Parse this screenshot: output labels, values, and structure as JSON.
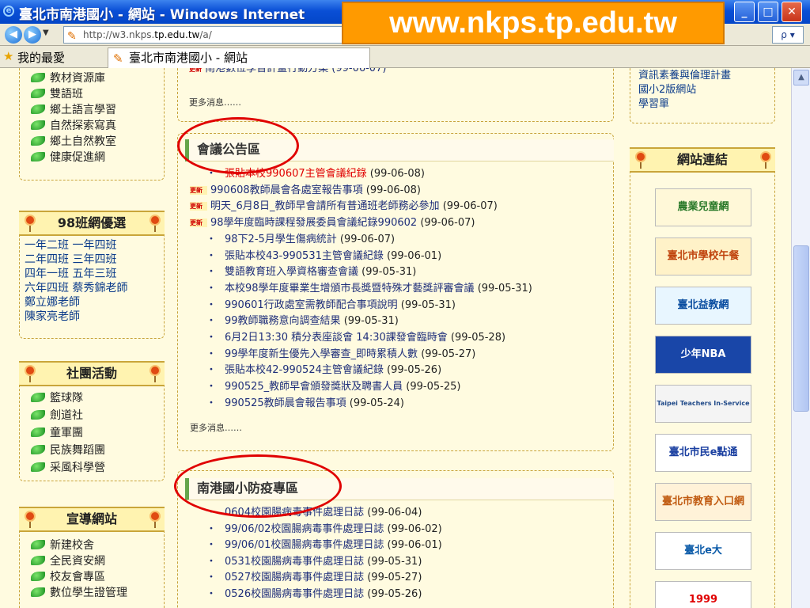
{
  "window": {
    "title": "臺北市南港國小 - 網站 - Windows Internet",
    "buttons": [
      "_",
      "□",
      "✕"
    ]
  },
  "banner_url": "www.nkps.tp.edu.tw",
  "address_bar": {
    "url_prefix": "http://w3.nkps.",
    "url_domain": "tp.edu.tw",
    "url_suffix": "/a/",
    "search_icon_label": "ρ"
  },
  "favorites_bar": {
    "favorites_label": "我的最愛",
    "tab_title": "臺北市南港國小 - 網站"
  },
  "left_sidebar": {
    "top_links": [
      "教材資源庫",
      "雙語班",
      "鄉土語言學習",
      "自然探索寫真",
      "鄉土自然教室",
      "健康促進網"
    ],
    "class_box": {
      "title": "98班網優選",
      "lines": [
        "一年二班 一年四班",
        "二年四班 三年四班",
        "四年一班 五年三班",
        "六年四班 蔡秀錦老師",
        "鄭立娜老師",
        "陳家亮老師"
      ]
    },
    "club_box": {
      "title": "社團活動",
      "links": [
        "籃球隊",
        "劍道社",
        "童軍團",
        "民族舞蹈團",
        "采風科學營"
      ]
    },
    "promo_box": {
      "title": "宣導網站",
      "links": [
        "新建校舍",
        "全民資安網",
        "校友會專區",
        "數位學生證管理"
      ]
    }
  },
  "main": {
    "top_partial_item": "南港數位學習計畫行動方案 (99-06-07)",
    "more_label": "更多消息……",
    "meetings": {
      "title": "會議公告區",
      "items": [
        {
          "text": "張貼本校990607主管會議紀錄",
          "date": "(99-06-08)",
          "new": false,
          "red": true
        },
        {
          "text": "990608教師晨會各處室報告事項",
          "date": "(99-06-08)",
          "new": true,
          "red": false
        },
        {
          "text": "明天_6月8日_教師早會請所有普通班老師務必參加",
          "date": "(99-06-07)",
          "new": true,
          "red": false
        },
        {
          "text": "98學年度臨時課程發展委員會議紀錄990602",
          "date": "(99-06-07)",
          "new": true,
          "red": false
        },
        {
          "text": "98下2-5月學生傷病統計",
          "date": "(99-06-07)",
          "new": false,
          "red": false
        },
        {
          "text": "張貼本校43-990531主管會議紀錄",
          "date": "(99-06-01)",
          "new": false,
          "red": false
        },
        {
          "text": "雙語教育班入學資格審查會議",
          "date": "(99-05-31)",
          "new": false,
          "red": false
        },
        {
          "text": "本校98學年度畢業生增頒市長獎暨特殊才藝獎評審會議",
          "date": "(99-05-31)",
          "new": false,
          "red": false
        },
        {
          "text": "990601行政處室需教師配合事項說明",
          "date": "(99-05-31)",
          "new": false,
          "red": false
        },
        {
          "text": "99教師職務意向調查結果",
          "date": "(99-05-31)",
          "new": false,
          "red": false
        },
        {
          "text": "6月2日13:30 積分表座談會 14:30課發會臨時會",
          "date": "(99-05-28)",
          "new": false,
          "red": false
        },
        {
          "text": "99學年度新生優先入學審查_即時累積人數",
          "date": "(99-05-27)",
          "new": false,
          "red": false
        },
        {
          "text": "張貼本校42-990524主管會議紀錄",
          "date": "(99-05-26)",
          "new": false,
          "red": false
        },
        {
          "text": "990525_教師早會頒發獎狀及聘書人員",
          "date": "(99-05-25)",
          "new": false,
          "red": false
        },
        {
          "text": "990525教師晨會報告事項",
          "date": "(99-05-24)",
          "new": false,
          "red": false
        }
      ]
    },
    "epidemic": {
      "title": "南港國小防疫專區",
      "items": [
        {
          "text": "0604校園腸病毒事件處理日誌",
          "date": "(99-06-04)"
        },
        {
          "text": "99/06/02校園腸病毒事件處理日誌",
          "date": "(99-06-02)"
        },
        {
          "text": "99/06/01校園腸病毒事件處理日誌",
          "date": "(99-06-01)"
        },
        {
          "text": "0531校園腸病毒事件處理日誌",
          "date": "(99-05-31)"
        },
        {
          "text": "0527校園腸病毒事件處理日誌",
          "date": "(99-05-27)"
        },
        {
          "text": "0526校園腸病毒事件處理日誌",
          "date": "(99-05-26)"
        }
      ]
    },
    "new_badge": "更新",
    "bullet": "・"
  },
  "right_sidebar": {
    "top_links": [
      "資訊素養與倫理計畫",
      "國小2版網站",
      "學習單"
    ],
    "links_box": {
      "title": "網站連結",
      "logos": [
        {
          "label": "農業兒童網",
          "bg": "#fff8d8",
          "fg": "#2a7a2a"
        },
        {
          "label": "臺北市學校午餐",
          "bg": "#fff2c8",
          "fg": "#c0440e"
        },
        {
          "label": "臺北益教網",
          "bg": "#e8f6ff",
          "fg": "#0a4da0"
        },
        {
          "label": "少年NBA",
          "bg": "#1946a8",
          "fg": "#ffffff"
        },
        {
          "label": "Taipei Teachers In-Service Information",
          "bg": "#f4f4f4",
          "fg": "#234c8a"
        },
        {
          "label": "臺北市民e點通",
          "bg": "#ffffff",
          "fg": "#1a3fa0"
        },
        {
          "label": "臺北市教育入口網",
          "bg": "#fff2d8",
          "fg": "#c05a10"
        },
        {
          "label": "臺北e大",
          "bg": "#ffffff",
          "fg": "#0a5aa8"
        },
        {
          "label": "1999",
          "bg": "#ffffff",
          "fg": "#e00000"
        }
      ]
    }
  }
}
